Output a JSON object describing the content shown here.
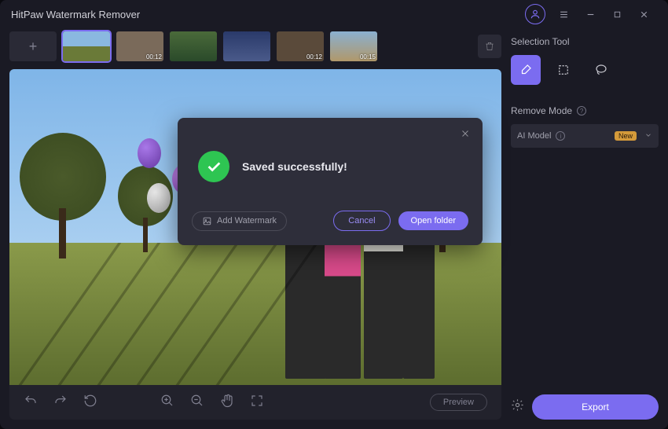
{
  "title": "HitPaw Watermark Remover",
  "thumbnails": [
    {
      "duration": ""
    },
    {
      "duration": "00:12"
    },
    {
      "duration": ""
    },
    {
      "duration": ""
    },
    {
      "duration": "00:12"
    },
    {
      "duration": "00:15"
    }
  ],
  "toolbar": {
    "preview_label": "Preview"
  },
  "sidebar": {
    "selection_label": "Selection Tool",
    "remove_mode_label": "Remove Mode",
    "mode_value": "AI Model",
    "mode_badge": "New",
    "export_label": "Export"
  },
  "modal": {
    "message": "Saved successfully!",
    "add_watermark_label": "Add Watermark",
    "cancel_label": "Cancel",
    "open_folder_label": "Open folder"
  },
  "colors": {
    "accent": "#7b6cf0",
    "success": "#2ec552"
  }
}
